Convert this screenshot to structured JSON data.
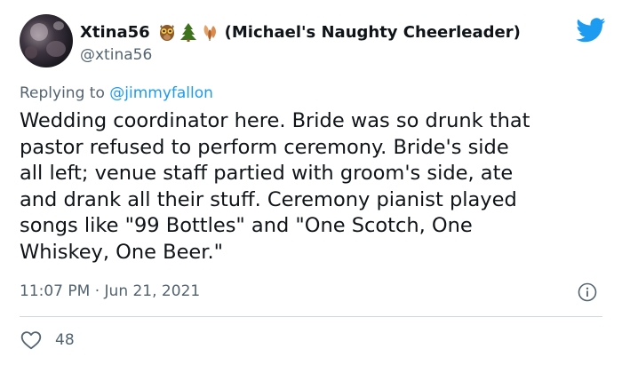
{
  "tweet": {
    "author": {
      "display_name": "Xtina56",
      "emojis": [
        "owl-icon",
        "evergreen-tree-icon",
        "maple-leaves-icon"
      ],
      "display_suffix": "(Michael's Naughty Cheerleader)",
      "handle": "@xtina56"
    },
    "reply_prefix": "Replying to",
    "reply_mention": "@jimmyfallon",
    "body_lines": [
      "Wedding coordinator here. Bride was so drunk that",
      "pastor refused to perform ceremony. Bride's side",
      "all left; venue staff partied with groom's side, ate",
      "and drank all their stuff. Ceremony pianist played",
      "songs like \"99 Bottles\" and \"One Scotch, One",
      "Whiskey, One Beer.\""
    ],
    "timestamp": "11:07 PM · Jun 21, 2021",
    "like_count": "48",
    "icons": {
      "brand": "twitter-bird-icon",
      "info": "info-icon",
      "like": "heart-icon"
    },
    "colors": {
      "accent": "#1d9bf0",
      "text": "#0f1419",
      "secondary": "#536471",
      "divider": "#cfd9de"
    }
  }
}
